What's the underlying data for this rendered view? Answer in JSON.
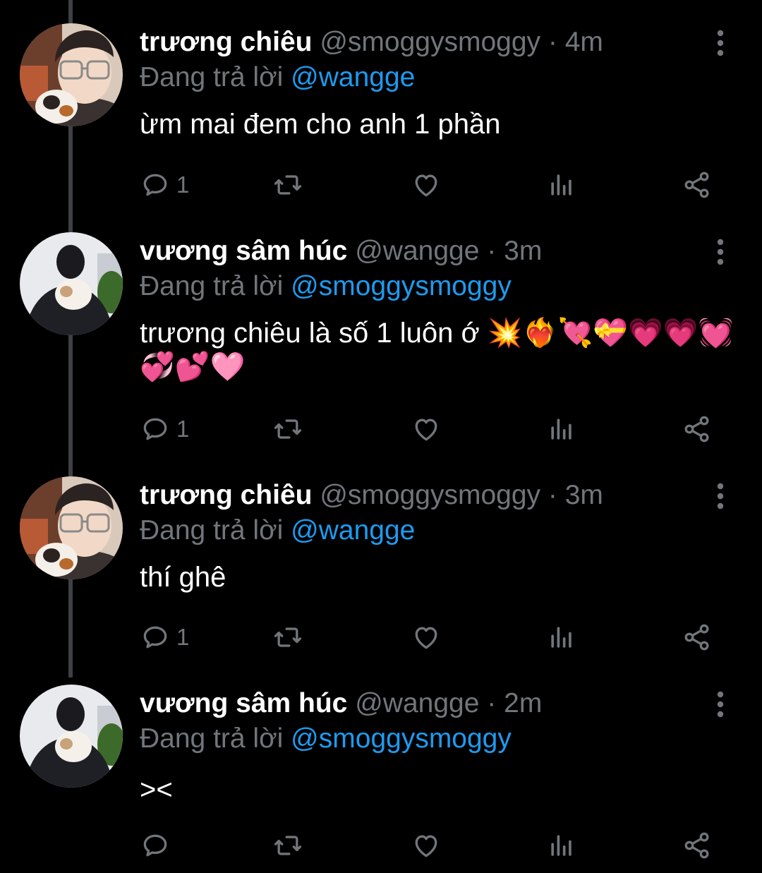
{
  "labels": {
    "replying_prefix": "Đang trả lời"
  },
  "tweets": [
    {
      "name": "trương chiêu",
      "handle": "@smoggysmoggy",
      "separator": "·",
      "time": "4m",
      "reply_to": "@wangge",
      "text": "ừm mai đem cho anh 1 phần",
      "reply_count": "1",
      "avatar": "avatar-glasses-person"
    },
    {
      "name": "vương sâm húc",
      "handle": "@wangge",
      "separator": "·",
      "time": "3m",
      "reply_to": "@smoggysmoggy",
      "text": "trương chiêu là số 1 luôn ớ 💥❤️‍🔥💘💝💗💗💓💞💕🩷",
      "reply_count": "1",
      "avatar": "avatar-person-holding-cat"
    },
    {
      "name": "trương chiêu",
      "handle": "@smoggysmoggy",
      "separator": "·",
      "time": "3m",
      "reply_to": "@wangge",
      "text": "thí ghê",
      "reply_count": "1",
      "avatar": "avatar-glasses-person"
    },
    {
      "name": "vương sâm húc",
      "handle": "@wangge",
      "separator": "·",
      "time": "2m",
      "reply_to": "@smoggysmoggy",
      "text": "><",
      "reply_count": "",
      "avatar": "avatar-person-holding-cat"
    }
  ],
  "icons": [
    "reply-icon",
    "retweet-icon",
    "like-icon",
    "views-icon",
    "share-icon",
    "more-icon"
  ],
  "colors": {
    "background": "#000000",
    "text": "#ffffff",
    "secondary": "#71767b",
    "mention": "#1d9bf0",
    "thread_line": "#3d4145"
  }
}
